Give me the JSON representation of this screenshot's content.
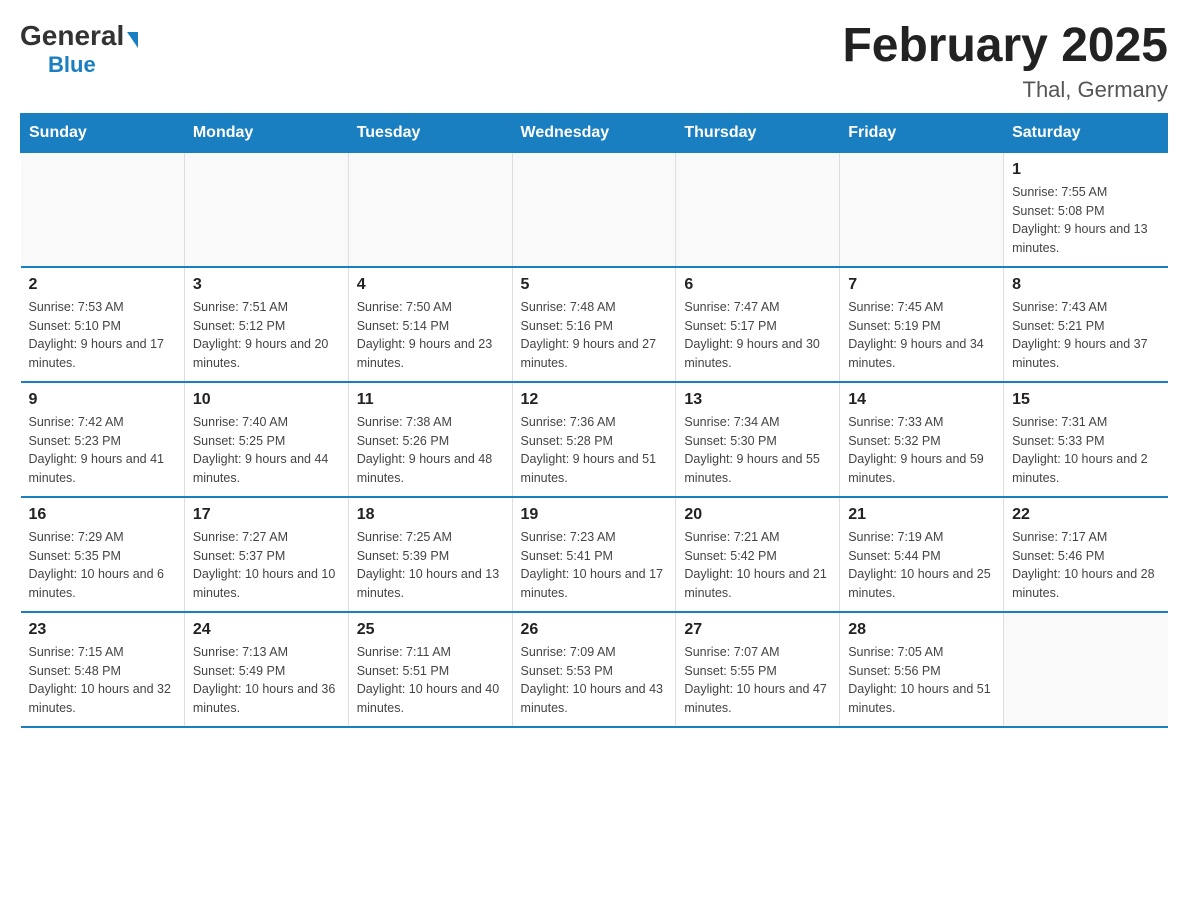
{
  "header": {
    "logo_general": "General",
    "logo_blue": "Blue",
    "title": "February 2025",
    "location": "Thal, Germany"
  },
  "calendar": {
    "days_of_week": [
      "Sunday",
      "Monday",
      "Tuesday",
      "Wednesday",
      "Thursday",
      "Friday",
      "Saturday"
    ],
    "weeks": [
      [
        {
          "day": "",
          "info": ""
        },
        {
          "day": "",
          "info": ""
        },
        {
          "day": "",
          "info": ""
        },
        {
          "day": "",
          "info": ""
        },
        {
          "day": "",
          "info": ""
        },
        {
          "day": "",
          "info": ""
        },
        {
          "day": "1",
          "info": "Sunrise: 7:55 AM\nSunset: 5:08 PM\nDaylight: 9 hours and 13 minutes."
        }
      ],
      [
        {
          "day": "2",
          "info": "Sunrise: 7:53 AM\nSunset: 5:10 PM\nDaylight: 9 hours and 17 minutes."
        },
        {
          "day": "3",
          "info": "Sunrise: 7:51 AM\nSunset: 5:12 PM\nDaylight: 9 hours and 20 minutes."
        },
        {
          "day": "4",
          "info": "Sunrise: 7:50 AM\nSunset: 5:14 PM\nDaylight: 9 hours and 23 minutes."
        },
        {
          "day": "5",
          "info": "Sunrise: 7:48 AM\nSunset: 5:16 PM\nDaylight: 9 hours and 27 minutes."
        },
        {
          "day": "6",
          "info": "Sunrise: 7:47 AM\nSunset: 5:17 PM\nDaylight: 9 hours and 30 minutes."
        },
        {
          "day": "7",
          "info": "Sunrise: 7:45 AM\nSunset: 5:19 PM\nDaylight: 9 hours and 34 minutes."
        },
        {
          "day": "8",
          "info": "Sunrise: 7:43 AM\nSunset: 5:21 PM\nDaylight: 9 hours and 37 minutes."
        }
      ],
      [
        {
          "day": "9",
          "info": "Sunrise: 7:42 AM\nSunset: 5:23 PM\nDaylight: 9 hours and 41 minutes."
        },
        {
          "day": "10",
          "info": "Sunrise: 7:40 AM\nSunset: 5:25 PM\nDaylight: 9 hours and 44 minutes."
        },
        {
          "day": "11",
          "info": "Sunrise: 7:38 AM\nSunset: 5:26 PM\nDaylight: 9 hours and 48 minutes."
        },
        {
          "day": "12",
          "info": "Sunrise: 7:36 AM\nSunset: 5:28 PM\nDaylight: 9 hours and 51 minutes."
        },
        {
          "day": "13",
          "info": "Sunrise: 7:34 AM\nSunset: 5:30 PM\nDaylight: 9 hours and 55 minutes."
        },
        {
          "day": "14",
          "info": "Sunrise: 7:33 AM\nSunset: 5:32 PM\nDaylight: 9 hours and 59 minutes."
        },
        {
          "day": "15",
          "info": "Sunrise: 7:31 AM\nSunset: 5:33 PM\nDaylight: 10 hours and 2 minutes."
        }
      ],
      [
        {
          "day": "16",
          "info": "Sunrise: 7:29 AM\nSunset: 5:35 PM\nDaylight: 10 hours and 6 minutes."
        },
        {
          "day": "17",
          "info": "Sunrise: 7:27 AM\nSunset: 5:37 PM\nDaylight: 10 hours and 10 minutes."
        },
        {
          "day": "18",
          "info": "Sunrise: 7:25 AM\nSunset: 5:39 PM\nDaylight: 10 hours and 13 minutes."
        },
        {
          "day": "19",
          "info": "Sunrise: 7:23 AM\nSunset: 5:41 PM\nDaylight: 10 hours and 17 minutes."
        },
        {
          "day": "20",
          "info": "Sunrise: 7:21 AM\nSunset: 5:42 PM\nDaylight: 10 hours and 21 minutes."
        },
        {
          "day": "21",
          "info": "Sunrise: 7:19 AM\nSunset: 5:44 PM\nDaylight: 10 hours and 25 minutes."
        },
        {
          "day": "22",
          "info": "Sunrise: 7:17 AM\nSunset: 5:46 PM\nDaylight: 10 hours and 28 minutes."
        }
      ],
      [
        {
          "day": "23",
          "info": "Sunrise: 7:15 AM\nSunset: 5:48 PM\nDaylight: 10 hours and 32 minutes."
        },
        {
          "day": "24",
          "info": "Sunrise: 7:13 AM\nSunset: 5:49 PM\nDaylight: 10 hours and 36 minutes."
        },
        {
          "day": "25",
          "info": "Sunrise: 7:11 AM\nSunset: 5:51 PM\nDaylight: 10 hours and 40 minutes."
        },
        {
          "day": "26",
          "info": "Sunrise: 7:09 AM\nSunset: 5:53 PM\nDaylight: 10 hours and 43 minutes."
        },
        {
          "day": "27",
          "info": "Sunrise: 7:07 AM\nSunset: 5:55 PM\nDaylight: 10 hours and 47 minutes."
        },
        {
          "day": "28",
          "info": "Sunrise: 7:05 AM\nSunset: 5:56 PM\nDaylight: 10 hours and 51 minutes."
        },
        {
          "day": "",
          "info": ""
        }
      ]
    ]
  }
}
